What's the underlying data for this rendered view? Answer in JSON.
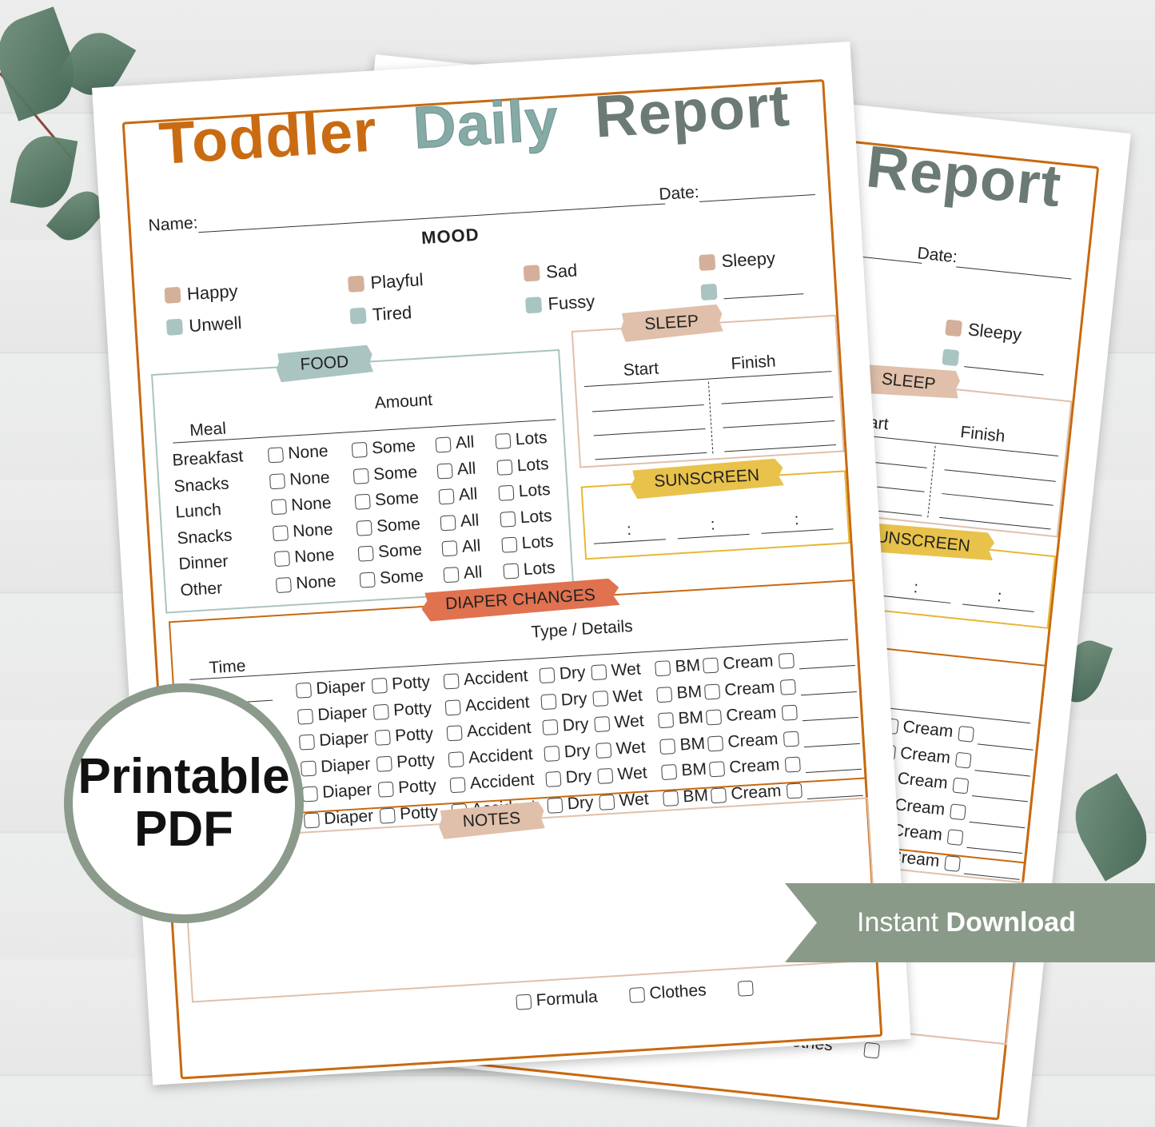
{
  "title": {
    "words": [
      "Toddler",
      "Daily",
      "Report"
    ],
    "letter_colors": [
      [
        "#c96b12",
        "#e9b737",
        "#6c7a74",
        "#6c7a74",
        "#c96b12",
        "#e9b737",
        "#6c7a74"
      ],
      [
        "#a9c4c1",
        "#a9c4c1",
        "#a9c4c1",
        "#a9c4c1",
        "#c96b12"
      ],
      [
        "#6c7a74",
        "#6c7a74",
        "#e9b737",
        "#c96b12",
        "#d4b8a4",
        "#d4b8a4"
      ]
    ]
  },
  "header": {
    "name_label": "Name:",
    "date_label": "Date:"
  },
  "mood": {
    "title": "MOOD",
    "items": [
      {
        "label": "Happy",
        "color": "#d4b09a"
      },
      {
        "label": "Unwell",
        "color": "#a9c4c1"
      },
      {
        "label": "Playful",
        "color": "#d4b09a"
      },
      {
        "label": "Tired",
        "color": "#a9c4c1"
      },
      {
        "label": "Sad",
        "color": "#d4b09a"
      },
      {
        "label": "Fussy",
        "color": "#a9c4c1"
      },
      {
        "label": "Sleepy",
        "color": "#d4b09a"
      },
      {
        "label": "",
        "color": "#a9c4c1"
      }
    ]
  },
  "food": {
    "title": "FOOD",
    "color": "#a9c4c1",
    "meal_header": "Meal",
    "amount_header": "Amount",
    "meals": [
      "Breakfast",
      "Snacks",
      "Lunch",
      "Snacks",
      "Dinner",
      "Other"
    ],
    "options": [
      "None",
      "Some",
      "All",
      "Lots"
    ]
  },
  "sleep": {
    "title": "SLEEP",
    "color": "#e0c0aa",
    "start": "Start",
    "finish": "Finish"
  },
  "sunscreen": {
    "title": "SUNSCREEN",
    "color": "#e8c24a",
    "separator": ":"
  },
  "diaper": {
    "title": "DIAPER CHANGES",
    "color": "#e07250",
    "time_header": "Time",
    "type_header": "Type / Details",
    "options": [
      "Diaper",
      "Potty",
      "Accident",
      "Dry",
      "Wet",
      "BM",
      "Cream"
    ]
  },
  "notes": {
    "title": "NOTES",
    "color": "#e0c0aa"
  },
  "supplies": {
    "options": [
      "Formula",
      "Clothes"
    ]
  },
  "badge": {
    "line1": "Printable",
    "line2": "PDF"
  },
  "ribbon": {
    "regular": "Instant ",
    "bold": "Download"
  },
  "colors": {
    "accent": "#c8690f",
    "badge_ring": "#8b9a8b",
    "ribbon": "#8a9a89"
  }
}
